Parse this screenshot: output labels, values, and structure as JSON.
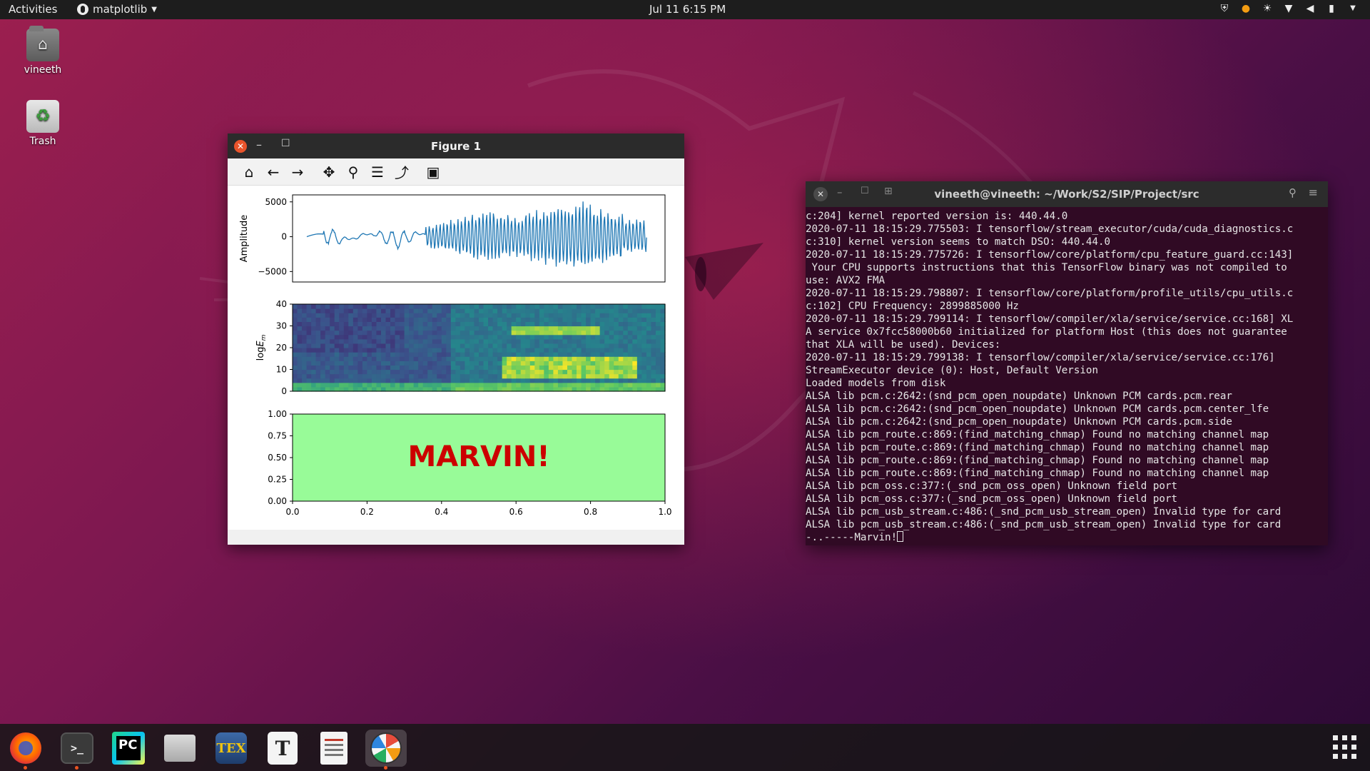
{
  "topbar": {
    "activities": "Activities",
    "app_menu": "matplotlib",
    "clock": "Jul 11  6:15 PM"
  },
  "desktop": {
    "icons": [
      {
        "label": "vineeth",
        "icon": "home-folder-icon"
      },
      {
        "label": "Trash",
        "icon": "trash-icon"
      }
    ]
  },
  "figure_window": {
    "title": "Figure 1",
    "toolbar": [
      "home-icon",
      "back-arrow-icon",
      "forward-arrow-icon",
      "pan-icon",
      "zoom-icon",
      "configure-subplots-icon",
      "edit-axis-icon",
      "save-icon"
    ]
  },
  "chart_data": [
    {
      "type": "line",
      "ylabel": "Amplitude",
      "xlabel": "",
      "y_ticks": [
        "5000",
        "0",
        "−5000"
      ],
      "ylim": [
        -6500,
        6000
      ],
      "x_ticks_visible": false,
      "series": [
        {
          "color": "#1f77b4"
        }
      ]
    },
    {
      "type": "heatmap",
      "ylabel": "log E_m",
      "y_ticks": [
        "40",
        "30",
        "20",
        "10",
        "0"
      ],
      "ylim": [
        0,
        40
      ],
      "colormap": "viridis"
    },
    {
      "type": "table",
      "text": "MARVIN!",
      "text_color": "#cc0000",
      "background": "#98fb98",
      "y_ticks": [
        "1.00",
        "0.75",
        "0.50",
        "0.25",
        "0.00"
      ],
      "x_ticks": [
        "0.0",
        "0.2",
        "0.4",
        "0.6",
        "0.8",
        "1.0"
      ],
      "xlim": [
        0,
        1
      ],
      "ylim": [
        0,
        1
      ]
    }
  ],
  "terminal": {
    "title": "vineeth@vineeth: ~/Work/S2/SIP/Project/src",
    "lines": [
      "c:204] kernel reported version is: 440.44.0",
      "2020-07-11 18:15:29.775503: I tensorflow/stream_executor/cuda/cuda_diagnostics.c",
      "c:310] kernel version seems to match DSO: 440.44.0",
      "2020-07-11 18:15:29.775726: I tensorflow/core/platform/cpu_feature_guard.cc:143]",
      " Your CPU supports instructions that this TensorFlow binary was not compiled to",
      "use: AVX2 FMA",
      "2020-07-11 18:15:29.798807: I tensorflow/core/platform/profile_utils/cpu_utils.c",
      "c:102] CPU Frequency: 2899885000 Hz",
      "2020-07-11 18:15:29.799114: I tensorflow/compiler/xla/service/service.cc:168] XL",
      "A service 0x7fcc58000b60 initialized for platform Host (this does not guarantee",
      "that XLA will be used). Devices:",
      "2020-07-11 18:15:29.799138: I tensorflow/compiler/xla/service/service.cc:176]",
      "StreamExecutor device (0): Host, Default Version",
      "Loaded models from disk",
      "ALSA lib pcm.c:2642:(snd_pcm_open_noupdate) Unknown PCM cards.pcm.rear",
      "ALSA lib pcm.c:2642:(snd_pcm_open_noupdate) Unknown PCM cards.pcm.center_lfe",
      "ALSA lib pcm.c:2642:(snd_pcm_open_noupdate) Unknown PCM cards.pcm.side",
      "ALSA lib pcm_route.c:869:(find_matching_chmap) Found no matching channel map",
      "ALSA lib pcm_route.c:869:(find_matching_chmap) Found no matching channel map",
      "ALSA lib pcm_route.c:869:(find_matching_chmap) Found no matching channel map",
      "ALSA lib pcm_route.c:869:(find_matching_chmap) Found no matching channel map",
      "ALSA lib pcm_oss.c:377:(_snd_pcm_oss_open) Unknown field port",
      "ALSA lib pcm_oss.c:377:(_snd_pcm_oss_open) Unknown field port",
      "ALSA lib pcm_usb_stream.c:486:(_snd_pcm_usb_stream_open) Invalid type for card",
      "ALSA lib pcm_usb_stream.c:486:(_snd_pcm_usb_stream_open) Invalid type for card"
    ],
    "prompt_line": "-..-----Marvin!"
  },
  "dock": {
    "apps": [
      "firefox-icon",
      "terminal-icon",
      "pycharm-icon",
      "files-icon",
      "texmaker-icon",
      "typora-icon",
      "document-viewer-icon",
      "matplotlib-icon"
    ],
    "terminal_glyph": ">_",
    "pycharm_label": "PC",
    "texmaker_label": "TEX",
    "typora_label": "T"
  }
}
